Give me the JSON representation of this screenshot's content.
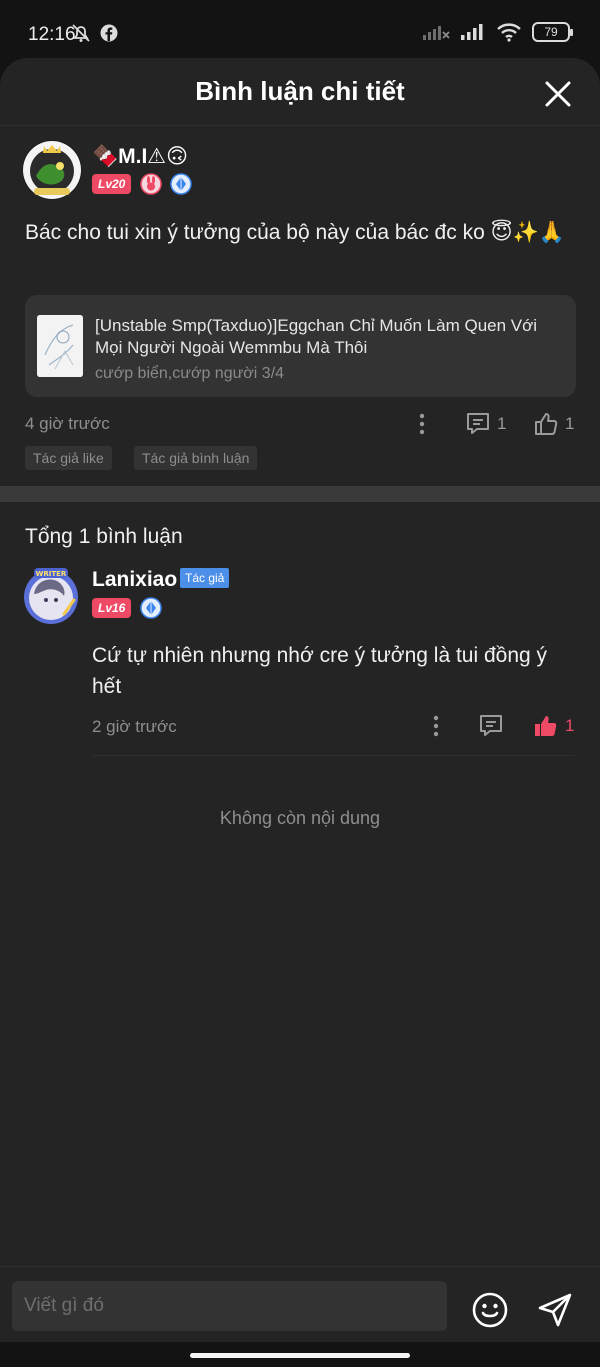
{
  "status": {
    "time": "12:16",
    "battery": "79"
  },
  "header": {
    "title": "Bình luận chi tiết"
  },
  "post": {
    "username": "🍫M.I⚠🙃",
    "level": "Lv20",
    "text": "Bác cho tui xin ý tưởng của bộ này của bác đc ko 😇✨🙏",
    "book": {
      "title": "[Unstable Smp(Taxduo)]Eggchan Chỉ Muốn Làm Quen Với Mọi Người Ngoài Wemmbu Mà Thôi",
      "subtitle": "cướp biển,cướp người 3/4"
    },
    "time": "4 giờ trước",
    "comment_count": "1",
    "like_count": "1",
    "tags": [
      "Tác giả like",
      "Tác giả bình luận"
    ]
  },
  "comments": {
    "total_label": "Tổng 1 bình luận",
    "items": [
      {
        "username": "Lanixiao",
        "author_tag": "Tác giả",
        "level": "Lv16",
        "text": "Cứ tự nhiên nhưng nhớ cre ý tưởng là tui đồng ý hết",
        "time": "2 giờ trước",
        "like_count": "1"
      }
    ],
    "end_text": "Không còn nội dung"
  },
  "input": {
    "placeholder": "Viết gì đó"
  },
  "colors": {
    "accent": "#ef4a65",
    "author_tag": "#4c8fe8",
    "sheet_bg": "#242424"
  }
}
